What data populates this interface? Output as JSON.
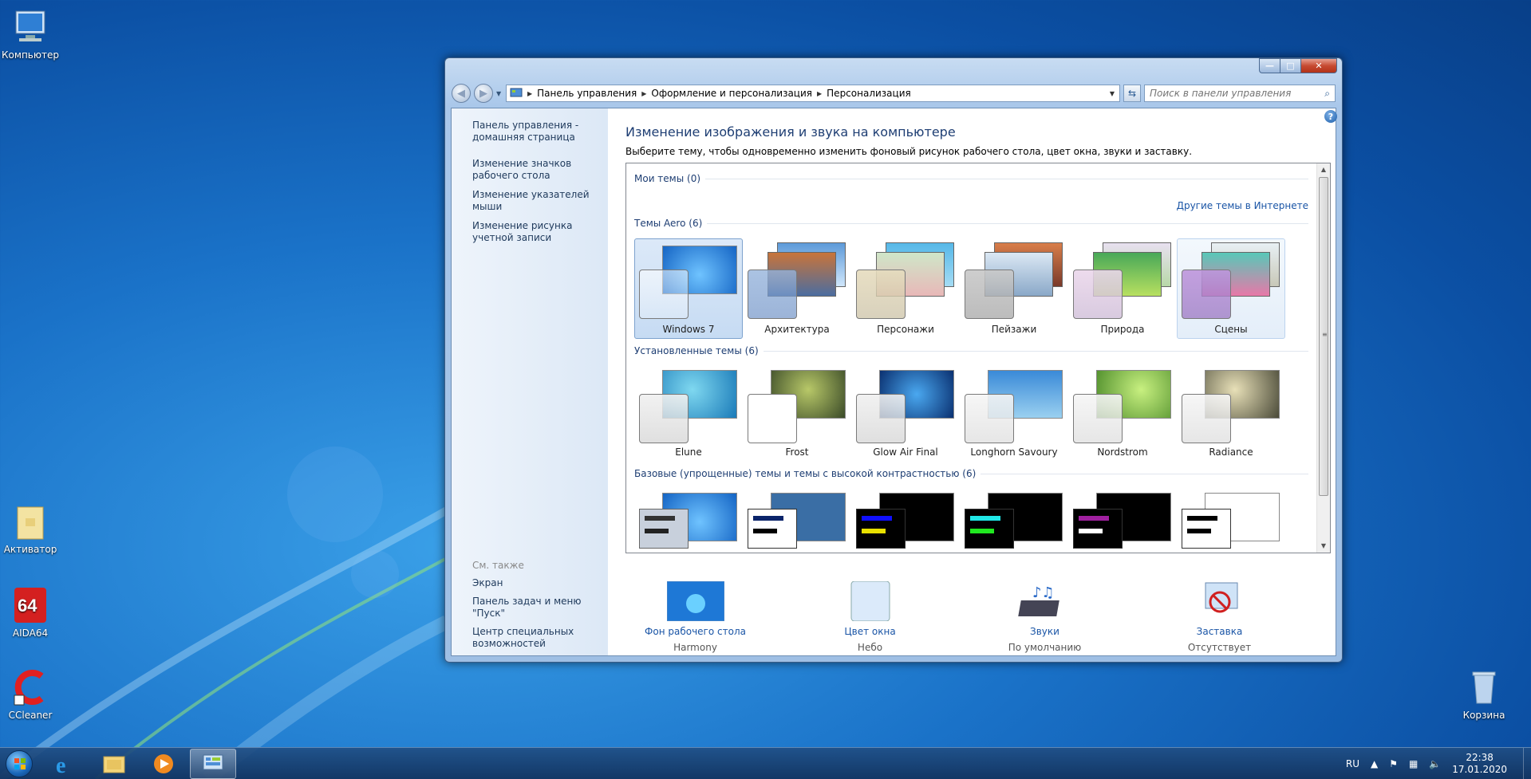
{
  "desktop": {
    "icons": [
      {
        "label": "Компьютер"
      },
      {
        "label": "Активатор"
      },
      {
        "label": "AIDA64"
      },
      {
        "label": "CCleaner"
      },
      {
        "label": "Корзина"
      }
    ]
  },
  "window": {
    "caption_buttons": {
      "minimize": "—",
      "maximize": "□",
      "close": "✕"
    },
    "breadcrumb": [
      "Панель управления",
      "Оформление и персонализация",
      "Персонализация"
    ],
    "search_placeholder": "Поиск в панели управления",
    "sidebar": {
      "home": "Панель управления - домашняя страница",
      "links": [
        "Изменение значков рабочего стола",
        "Изменение указателей мыши",
        "Изменение рисунка учетной записи"
      ],
      "see_also_header": "См. также",
      "see_also": [
        "Экран",
        "Панель задач и меню \"Пуск\"",
        "Центр специальных возможностей"
      ]
    },
    "main": {
      "title": "Изменение изображения и звука на компьютере",
      "description": "Выберите тему, чтобы одновременно изменить фоновый рисунок рабочего стола, цвет окна, звуки и заставку.",
      "groups": {
        "my_themes": "Мои темы (0)",
        "online_link": "Другие темы в Интернете",
        "aero": "Темы Aero (6)",
        "installed": "Установленные темы (6)",
        "basic": "Базовые (упрощенные) темы и темы с высокой контрастностью (6)"
      },
      "aero_themes": [
        "Windows 7",
        "Архитектура",
        "Персонажи",
        "Пейзажи",
        "Природа",
        "Сцены"
      ],
      "installed_themes": [
        "Elune",
        "Frost",
        "Glow Air Final",
        "Longhorn Savoury",
        "Nordstrom",
        "Radiance"
      ],
      "bottom": [
        {
          "title": "Фон рабочего стола",
          "subtitle": "Harmony"
        },
        {
          "title": "Цвет окна",
          "subtitle": "Небо"
        },
        {
          "title": "Звуки",
          "subtitle": "По умолчанию"
        },
        {
          "title": "Заставка",
          "subtitle": "Отсутствует"
        }
      ]
    }
  },
  "taskbar": {
    "lang": "RU",
    "time": "22:38",
    "date": "17.01.2020"
  },
  "colors": {
    "link": "#1a55a6",
    "heading": "#1e3e73",
    "desktop": "#1a72c8"
  }
}
